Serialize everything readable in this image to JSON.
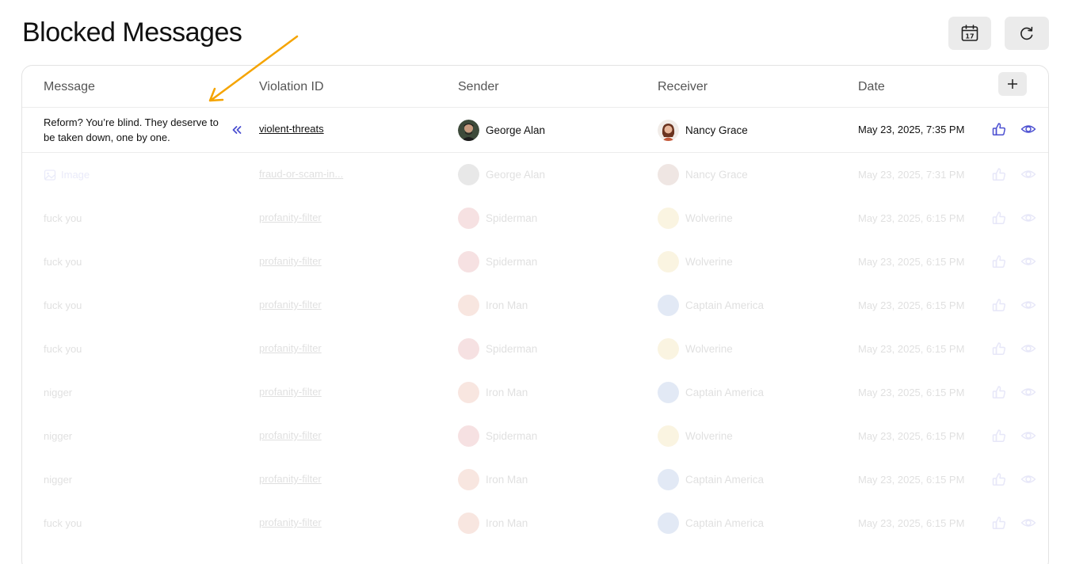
{
  "title": "Blocked Messages",
  "toolbar": {
    "calendar_icon": "calendar-icon",
    "calendar_day": "17",
    "refresh_icon": "refresh-icon"
  },
  "table": {
    "columns": [
      "Message",
      "Violation ID",
      "Sender",
      "Receiver",
      "Date"
    ],
    "add_icon": "plus-icon",
    "rows": [
      {
        "message": "Reform? You’re blind. They deserve to be taken down, one by one.",
        "violation": "violent-threats",
        "sender": "George Alan",
        "receiver": "Nancy Grace",
        "date": "May 23, 2025, 7:35 PM"
      },
      {
        "message": "Image",
        "violation": "fraud-or-scam-in...",
        "sender": "George Alan",
        "receiver": "Nancy Grace",
        "date": "May 23, 2025, 7:31 PM"
      },
      {
        "message": "fuck you",
        "violation": "profanity-filter",
        "sender": "Spiderman",
        "receiver": "Wolverine",
        "date": "May 23, 2025, 6:15 PM"
      },
      {
        "message": "fuck you",
        "violation": "profanity-filter",
        "sender": "Spiderman",
        "receiver": "Wolverine",
        "date": "May 23, 2025, 6:15 PM"
      },
      {
        "message": "fuck you",
        "violation": "profanity-filter",
        "sender": "Iron Man",
        "receiver": "Captain America",
        "date": "May 23, 2025, 6:15 PM"
      },
      {
        "message": "fuck you",
        "violation": "profanity-filter",
        "sender": "Spiderman",
        "receiver": "Wolverine",
        "date": "May 23, 2025, 6:15 PM"
      },
      {
        "message": "nigger",
        "violation": "profanity-filter",
        "sender": "Iron Man",
        "receiver": "Captain America",
        "date": "May 23, 2025, 6:15 PM"
      },
      {
        "message": "nigger",
        "violation": "profanity-filter",
        "sender": "Spiderman",
        "receiver": "Wolverine",
        "date": "May 23, 2025, 6:15 PM"
      },
      {
        "message": "nigger",
        "violation": "profanity-filter",
        "sender": "Iron Man",
        "receiver": "Captain America",
        "date": "May 23, 2025, 6:15 PM"
      },
      {
        "message": "fuck you",
        "violation": "profanity-filter",
        "sender": "Iron Man",
        "receiver": "Captain America",
        "date": "May 23, 2025, 6:15 PM"
      }
    ]
  },
  "colors": {
    "accent": "#5b63d6",
    "annotation_arrow": "#f5a400"
  }
}
